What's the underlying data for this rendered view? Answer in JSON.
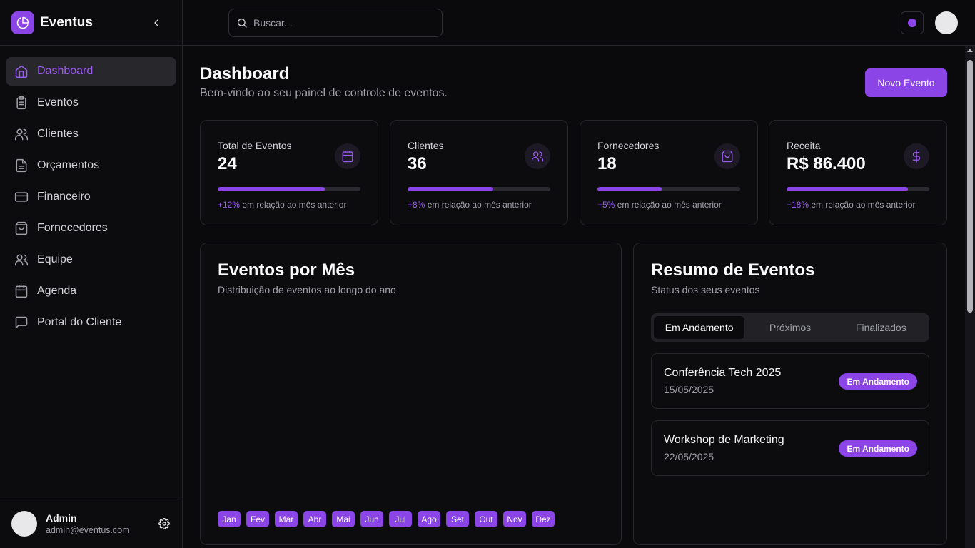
{
  "app": {
    "name": "Eventus"
  },
  "colors": {
    "accent": "#8b45e6",
    "background": "#0a0a0c",
    "border": "#26262b"
  },
  "sidebar": {
    "items": [
      {
        "label": "Dashboard",
        "icon": "home-icon",
        "active": true
      },
      {
        "label": "Eventos",
        "icon": "clipboard-icon"
      },
      {
        "label": "Clientes",
        "icon": "users-icon"
      },
      {
        "label": "Orçamentos",
        "icon": "file-text-icon"
      },
      {
        "label": "Financeiro",
        "icon": "credit-card-icon"
      },
      {
        "label": "Fornecedores",
        "icon": "shopping-bag-icon"
      },
      {
        "label": "Equipe",
        "icon": "users-icon"
      },
      {
        "label": "Agenda",
        "icon": "calendar-icon"
      },
      {
        "label": "Portal do Cliente",
        "icon": "message-square-icon"
      }
    ],
    "user": {
      "name": "Admin",
      "email": "admin@eventus.com"
    }
  },
  "topbar": {
    "search_placeholder": "Buscar..."
  },
  "header": {
    "title": "Dashboard",
    "subtitle": "Bem-vindo ao seu painel de controle de eventos.",
    "new_button": "Novo Evento"
  },
  "stats": [
    {
      "label": "Total de Eventos",
      "value": "24",
      "change": "+12%",
      "suffix": "em relação ao mês anterior",
      "progress": 0.75,
      "icon": "calendar-icon"
    },
    {
      "label": "Clientes",
      "value": "36",
      "change": "+8%",
      "suffix": "em relação ao mês anterior",
      "progress": 0.6,
      "icon": "users-icon"
    },
    {
      "label": "Fornecedores",
      "value": "18",
      "change": "+5%",
      "suffix": "em relação ao mês anterior",
      "progress": 0.45,
      "icon": "shopping-bag-icon"
    },
    {
      "label": "Receita",
      "value": "R$ 86.400",
      "change": "+18%",
      "suffix": "em relação ao mês anterior",
      "progress": 0.85,
      "icon": "dollar-icon"
    }
  ],
  "monthly": {
    "title": "Eventos por Mês",
    "subtitle": "Distribuição de eventos ao longo do ano",
    "months": [
      "Jan",
      "Fev",
      "Mar",
      "Abr",
      "Mai",
      "Jun",
      "Jul",
      "Ago",
      "Set",
      "Out",
      "Nov",
      "Dez"
    ]
  },
  "summary": {
    "title": "Resumo de Eventos",
    "subtitle": "Status dos seus eventos",
    "tabs": [
      "Em Andamento",
      "Próximos",
      "Finalizados"
    ],
    "events": [
      {
        "name": "Conferência Tech 2025",
        "date": "15/05/2025",
        "status": "Em Andamento"
      },
      {
        "name": "Workshop de Marketing",
        "date": "22/05/2025",
        "status": "Em Andamento"
      }
    ]
  }
}
